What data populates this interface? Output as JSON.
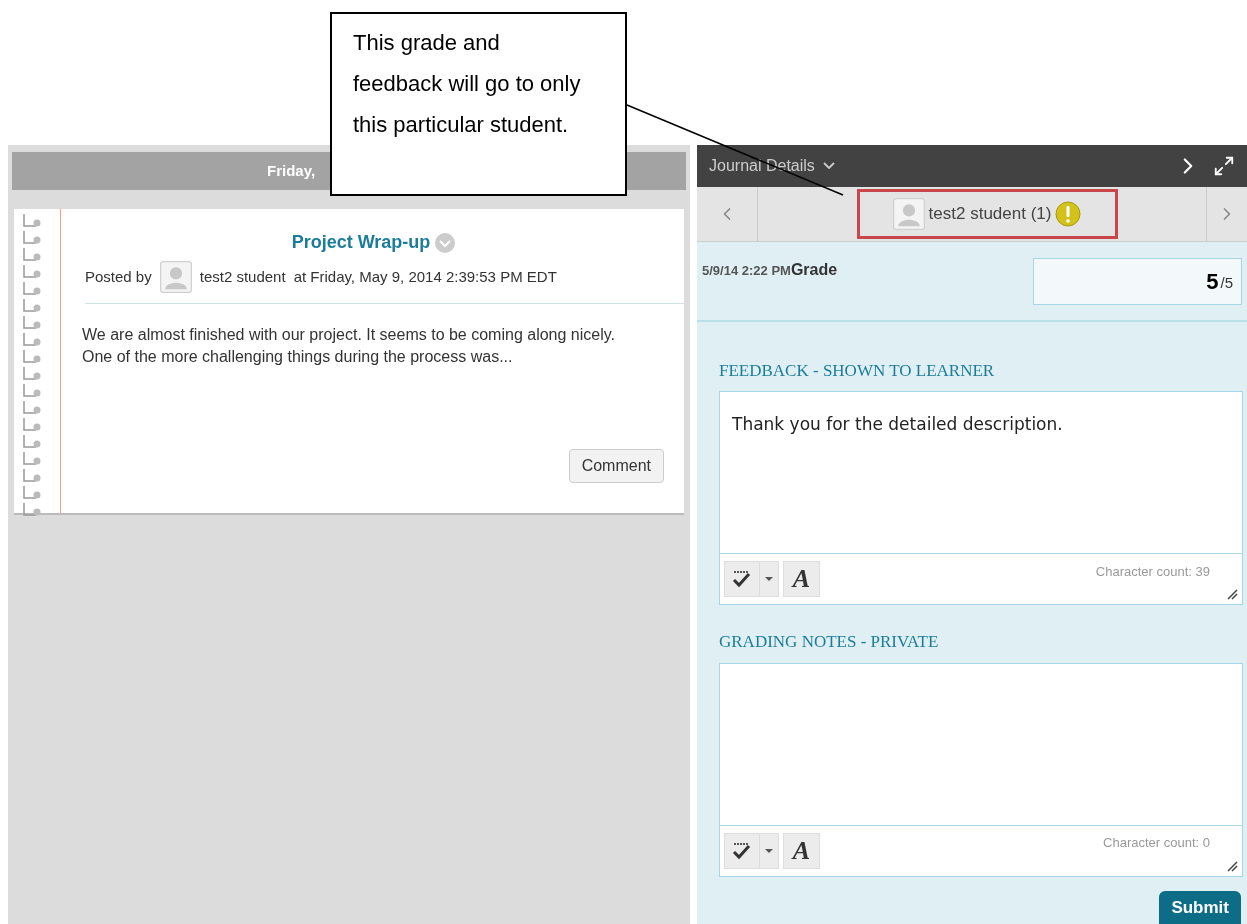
{
  "callout": {
    "text": "This grade and feedback will go to only this particular student."
  },
  "journal": {
    "date_header": "Friday,",
    "entry": {
      "title": "Project Wrap-up",
      "posted_by": "Posted by",
      "author": "test2 student",
      "timestamp": "at Friday, May 9, 2014 2:39:53 PM EDT",
      "body": "We are almost finished with our project. It seems to be coming along nicely. One of the more challenging things during the process was...",
      "comment_button": "Comment"
    }
  },
  "details": {
    "title": "Journal Details",
    "student": {
      "name": "test2 student (1)",
      "needs_grading": true
    },
    "attempt_time": "5/9/14 2:22 PM",
    "grade_label": "Grade",
    "grade_value": "5",
    "grade_max": "/5",
    "editors": [
      {
        "heading": "FEEDBACK - SHOWN TO LEARNER",
        "value": "Thank you for the detailed description.",
        "font_button": "A",
        "count": "Character count: 39"
      },
      {
        "heading": "GRADING NOTES - PRIVATE",
        "font_button": "A",
        "count": "Character count: 0"
      }
    ],
    "submit": "Submit"
  }
}
